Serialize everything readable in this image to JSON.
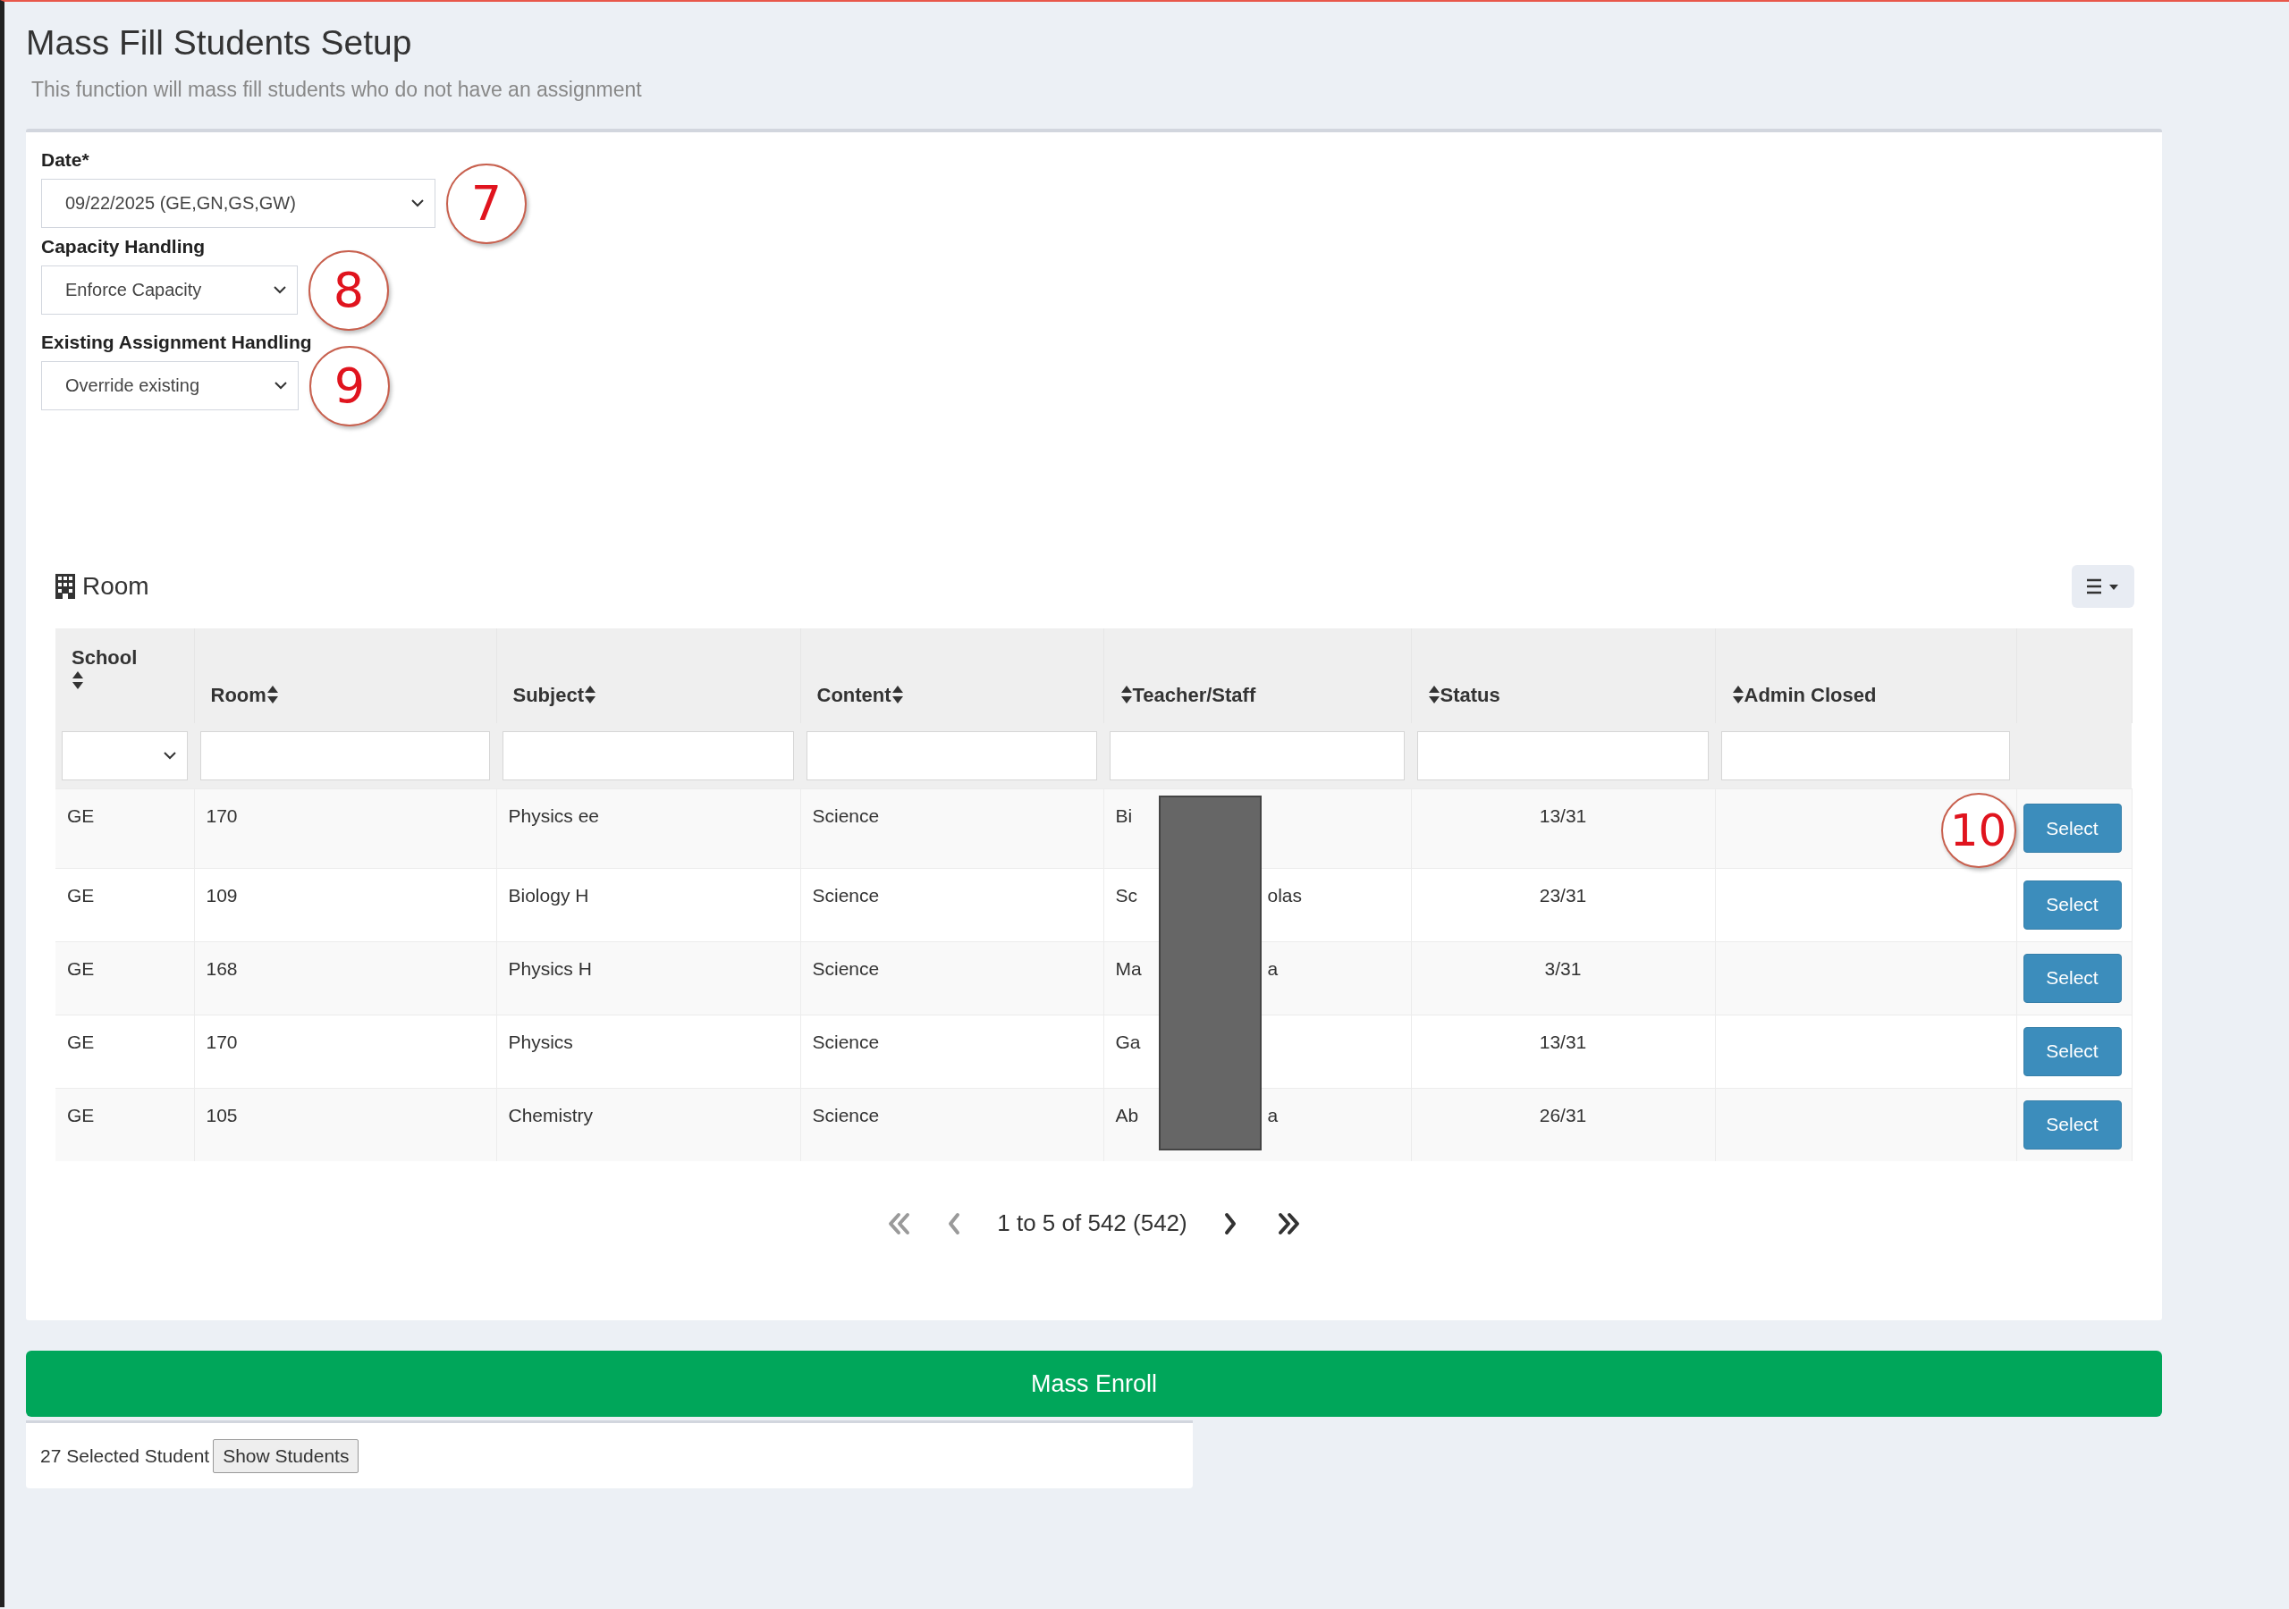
{
  "page": {
    "title": "Mass Fill Students Setup",
    "subtitle": "This function will mass fill students who do not have an assignment"
  },
  "form": {
    "fields": [
      {
        "label": "Date*",
        "value": "09/22/2025 (GE,GN,GS,GW)",
        "marker": "7"
      },
      {
        "label": "Capacity Handling",
        "value": "Enforce Capacity",
        "marker": "8"
      },
      {
        "label": "Existing Assignment Handling",
        "value": "Override existing",
        "marker": "9"
      }
    ]
  },
  "room_table": {
    "title": "Room",
    "columns": [
      {
        "label": "School",
        "kind": "select"
      },
      {
        "label": "Room",
        "kind": "text"
      },
      {
        "label": "Subject",
        "kind": "text"
      },
      {
        "label": "Content",
        "kind": "text"
      },
      {
        "label": "Teacher/Staff",
        "kind": "text"
      },
      {
        "label": "Status",
        "kind": "text"
      },
      {
        "label": "Admin Closed",
        "kind": "text"
      }
    ],
    "rows": [
      {
        "school": "GE",
        "room": "170",
        "subject": "Physics ee",
        "content": "Science",
        "teacher_start": "Bi",
        "teacher_end": "",
        "status": "13/31",
        "marker": "10",
        "action": "Select"
      },
      {
        "school": "GE",
        "room": "109",
        "subject": "Biology H",
        "content": "Science",
        "teacher_start": "Sc",
        "teacher_end": "olas",
        "status": "23/31",
        "action": "Select"
      },
      {
        "school": "GE",
        "room": "168",
        "subject": "Physics H",
        "content": "Science",
        "teacher_start": "Ma",
        "teacher_end": "a",
        "status": "3/31",
        "action": "Select"
      },
      {
        "school": "GE",
        "room": "170",
        "subject": "Physics",
        "content": "Science",
        "teacher_start": "Ga",
        "teacher_end": "",
        "status": "13/31",
        "action": "Select"
      },
      {
        "school": "GE",
        "room": "105",
        "subject": "Chemistry",
        "content": "Science",
        "teacher_start": "Ab",
        "teacher_end": "a",
        "status": "26/31",
        "action": "Select"
      }
    ],
    "pagination": {
      "summary": "1 to 5 of 542 (542)",
      "controls": [
        {
          "kind": "first",
          "disabled": true
        },
        {
          "kind": "prev",
          "disabled": true
        },
        {
          "kind": "next",
          "disabled": false
        },
        {
          "kind": "last",
          "disabled": false
        }
      ]
    }
  },
  "mass_enroll_button": "Mass Enroll",
  "footer": {
    "selected_count": "27 Selected Student",
    "show_button": "Show Students"
  }
}
